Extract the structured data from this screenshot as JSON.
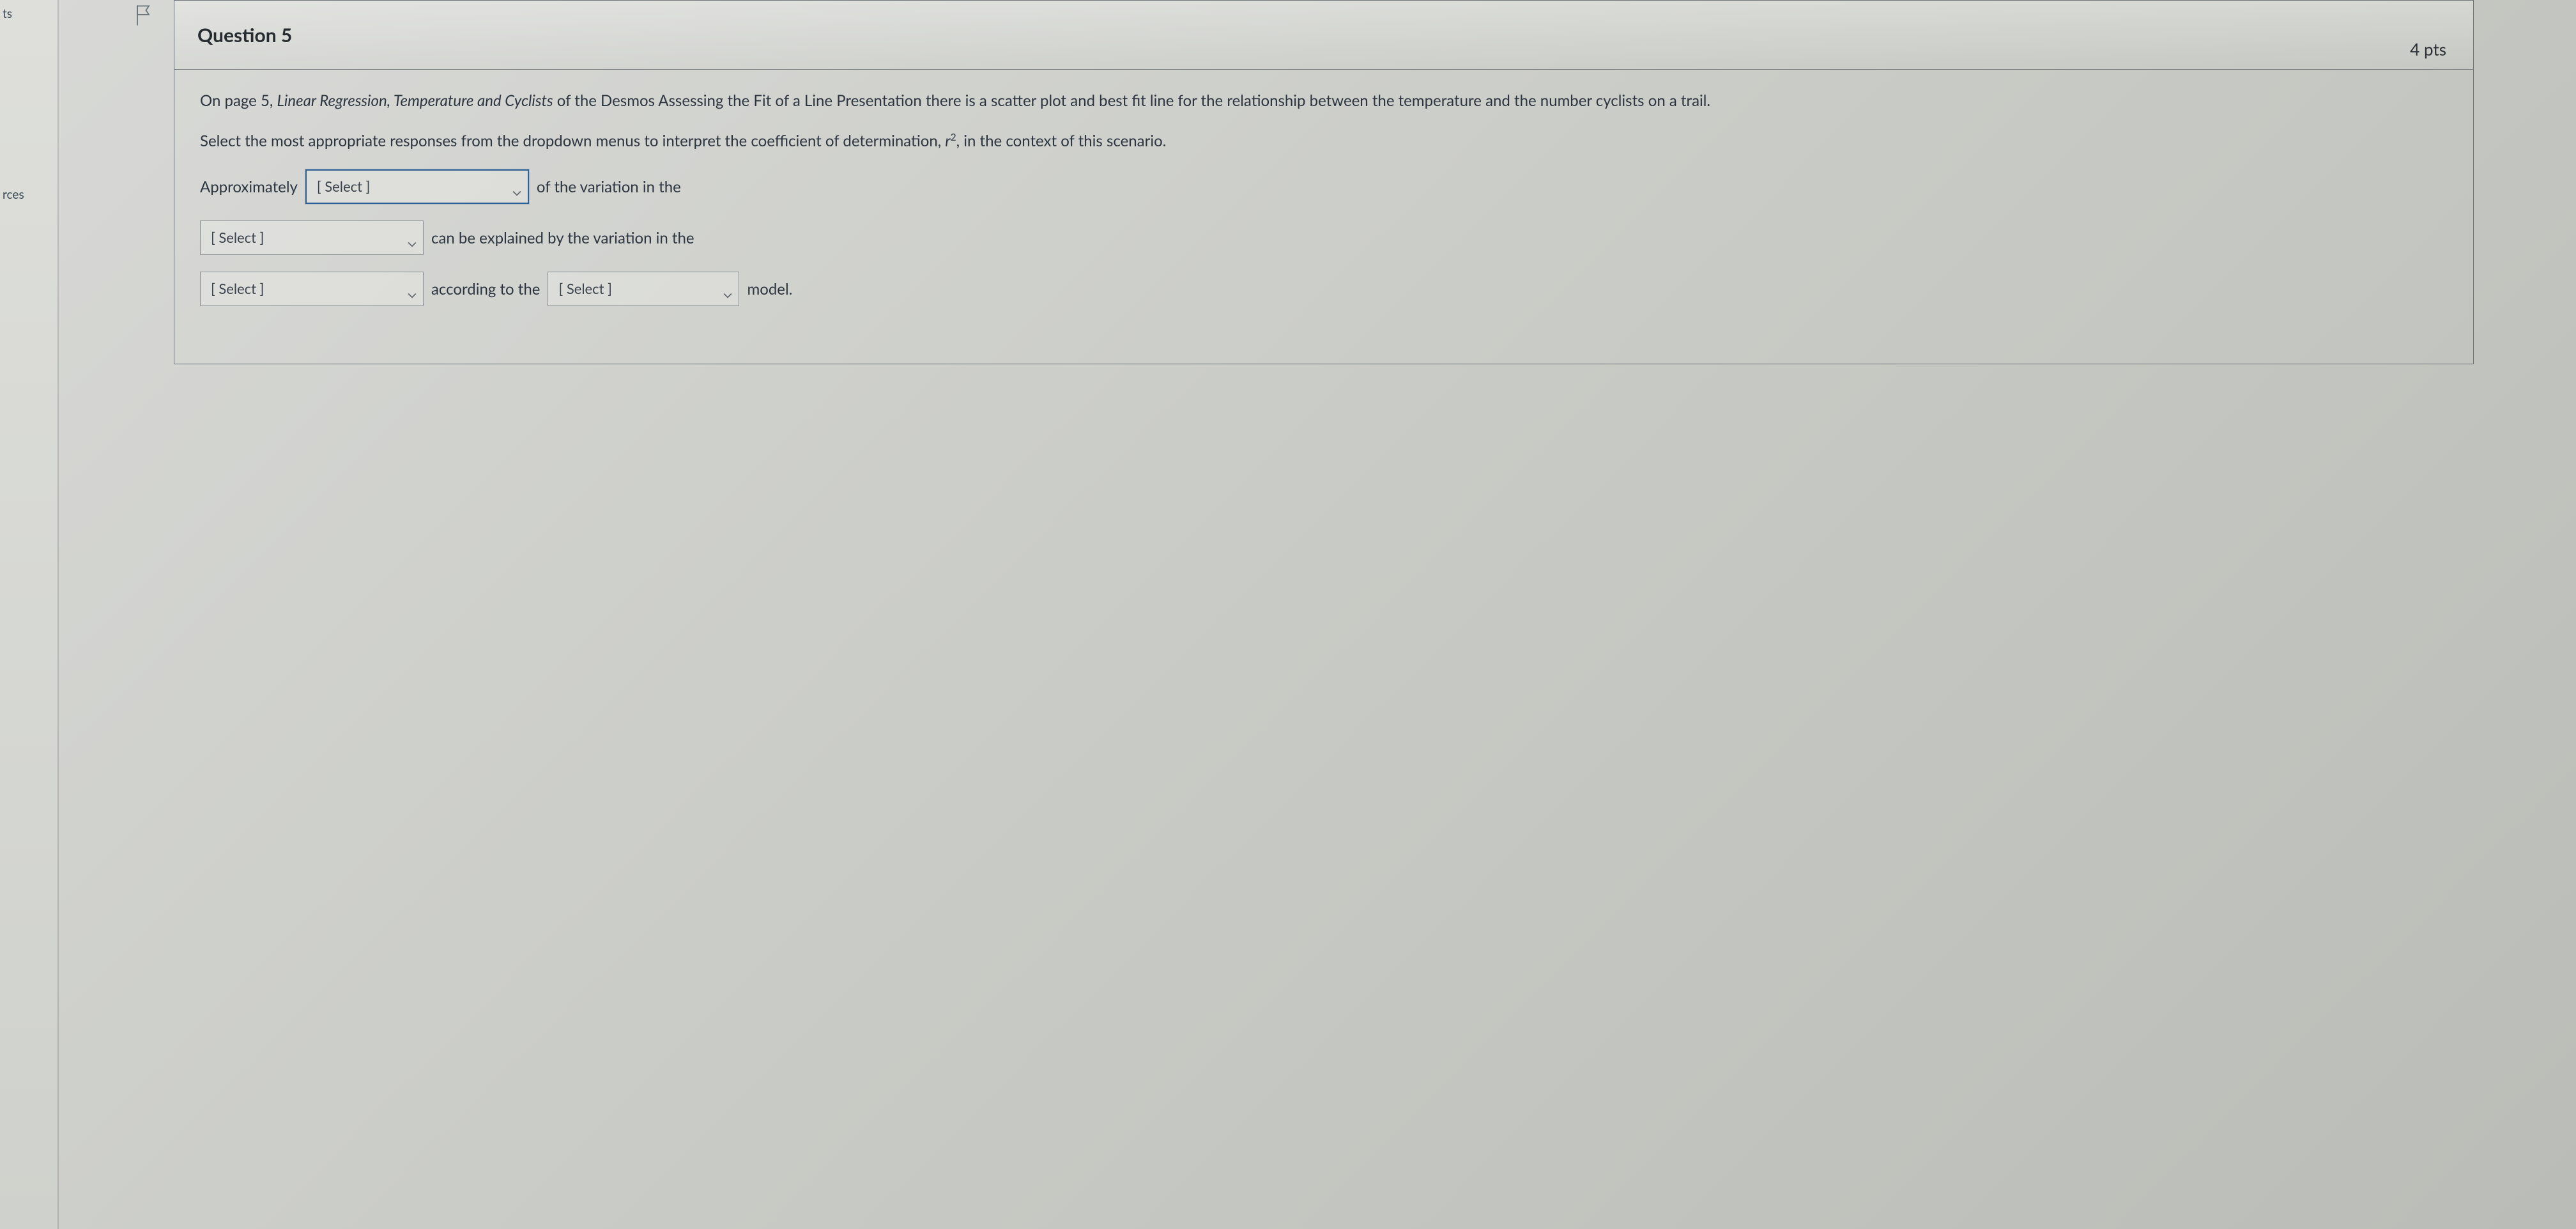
{
  "rail": {
    "item1": "ts",
    "item2": "rces"
  },
  "question": {
    "title": "Question 5",
    "points": "4 pts",
    "para1_a": "On page 5, ",
    "para1_b_italic": "Linear Regression, Temperature and Cyclists",
    "para1_c": " of the Desmos Assessing the Fit of a Line Presentation there is a scatter plot and best fit line for the relationship between the temperature and the number cyclists on a trail.",
    "para2_a": "Select the most appropriate responses from the dropdown menus to interpret the coefficient of determination, ",
    "para2_b_italic": "r",
    "para2_c": ", in the context of this scenario.",
    "line1_a": "Approximately",
    "line1_b": "of the variation in the",
    "line2_a": "can be explained by the variation in the",
    "line3_a": "according to the",
    "line3_b": "model.",
    "dropdown_placeholder": "[ Select ]"
  }
}
